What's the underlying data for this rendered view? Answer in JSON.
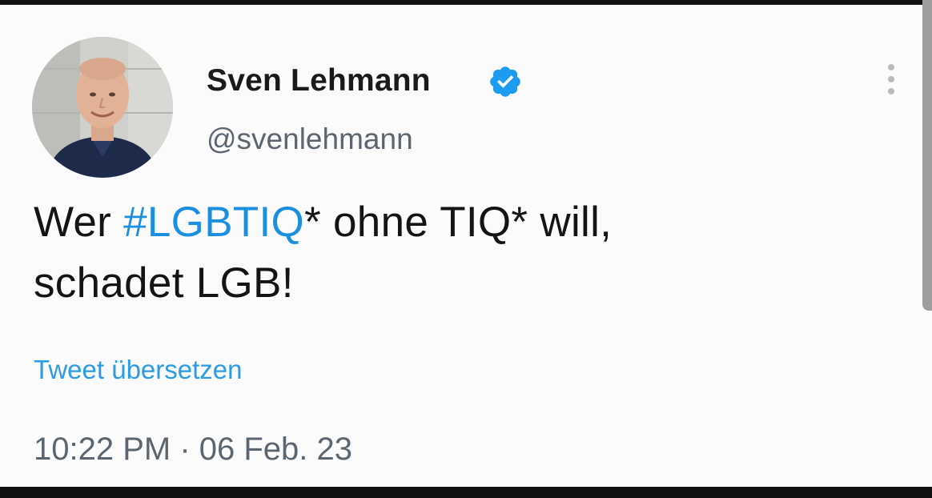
{
  "tweet": {
    "author": {
      "display_name": "Sven Lehmann",
      "handle": "@svenlehmann",
      "verified": true,
      "avatar": "profile-photo"
    },
    "text": {
      "prefix": "Wer ",
      "hashtag": "#LGBTIQ",
      "line1_rest": "* ohne TIQ* will,",
      "line2": "schadet LGB!"
    },
    "translate_label": "Tweet übersetzen",
    "time": "10:22 PM",
    "separator": " · ",
    "date": "06 Feb. 23",
    "menu_icon": "more-vertical-icon"
  },
  "colors": {
    "link_blue": "#1d8fe0",
    "verified_blue": "#1d9bf0",
    "text_dark": "#141414",
    "text_muted": "#5b6670",
    "background": "#fbfbfb"
  }
}
